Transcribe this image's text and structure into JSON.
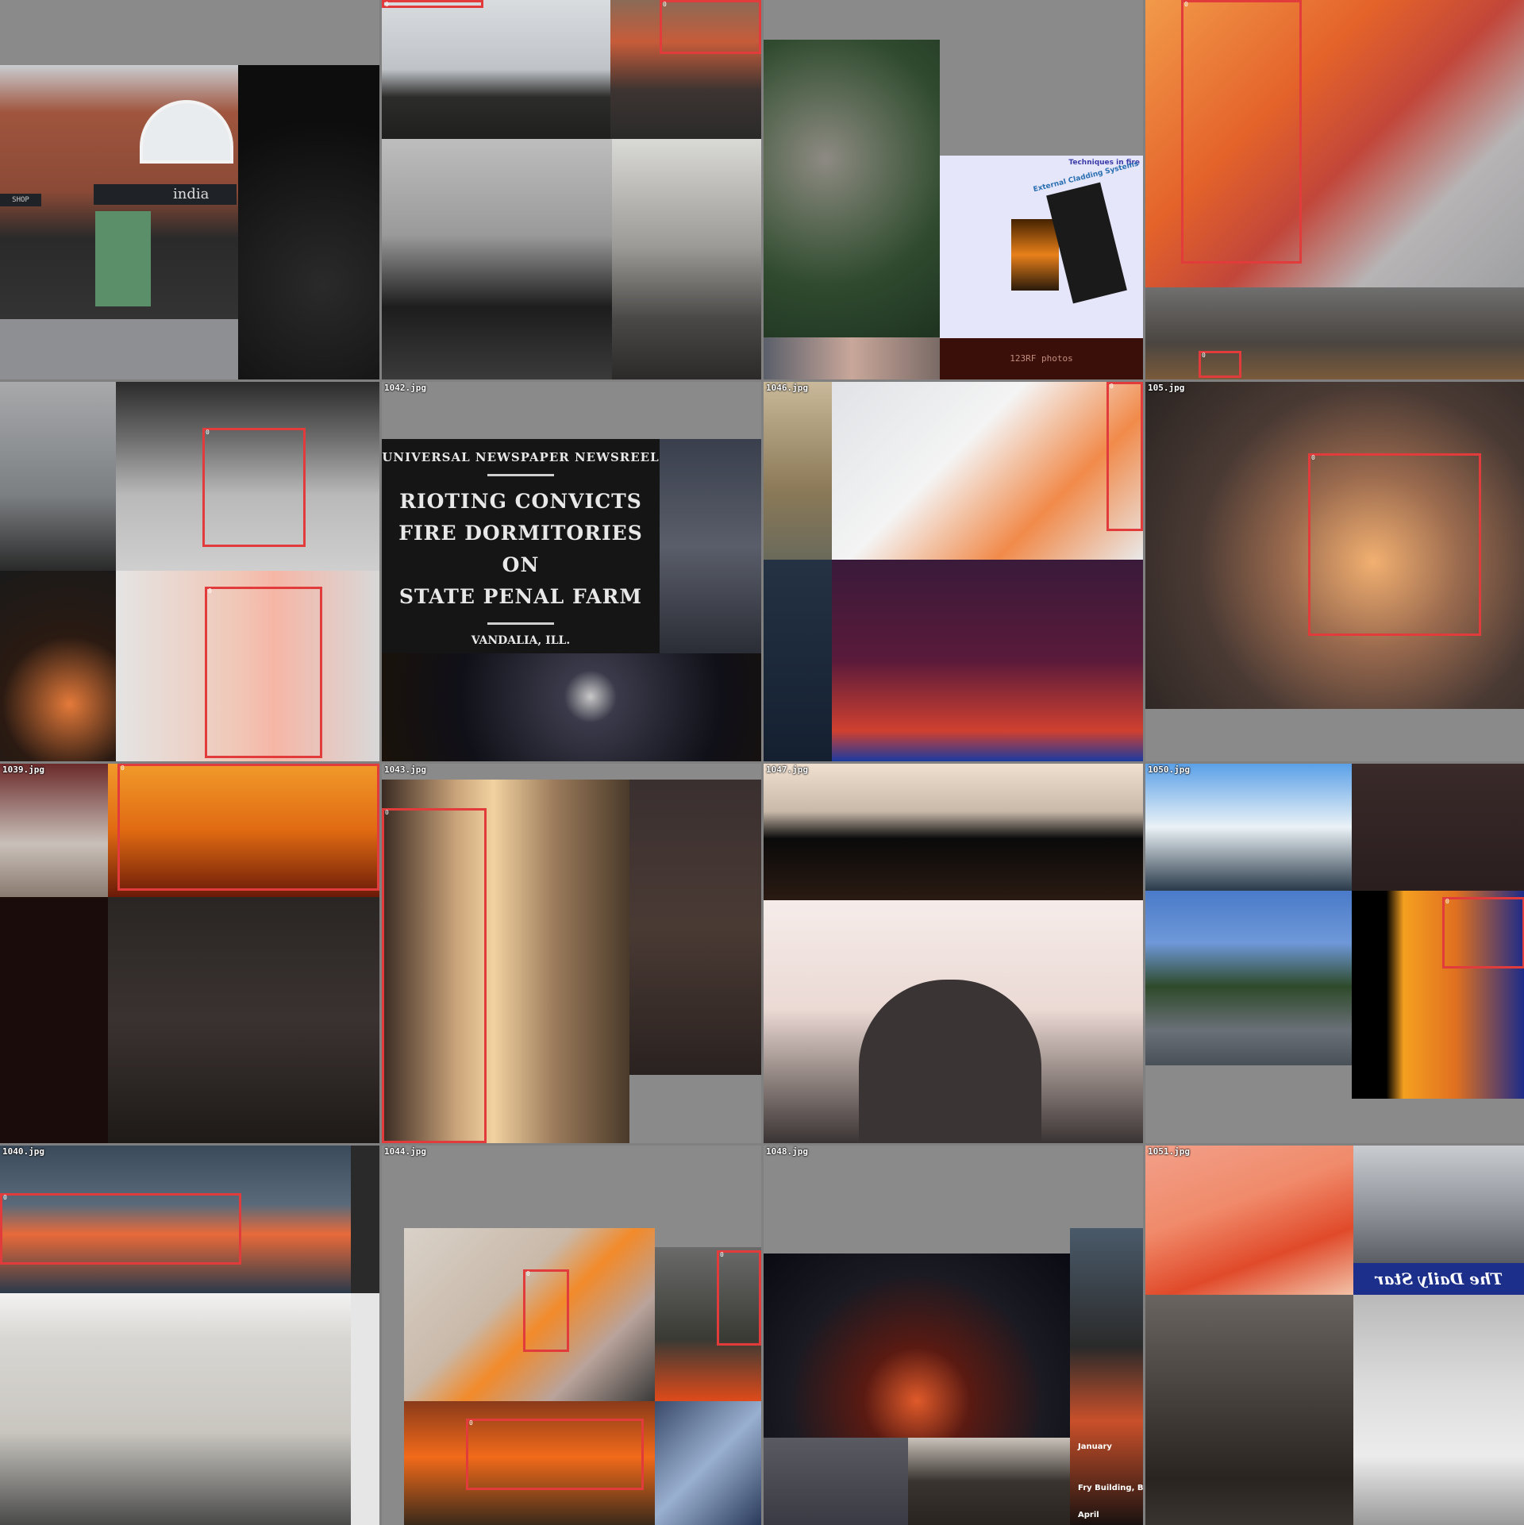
{
  "grid_labels": {
    "c5": "105.jpg",
    "c6": "1039.jpg",
    "c7": "1042.jpg",
    "c8": "1043.jpg",
    "c9": "1046.jpg",
    "c10": "1047.jpg",
    "c11": "1050.jpg",
    "c12": "1040.jpg",
    "c13": "1044.jpg",
    "c14": "1048.jpg",
    "c15": "1051.jpg"
  },
  "bbox_label": "0",
  "texts": {
    "shop_sign": "india",
    "shop_left": "SHOP",
    "doc_title": "Techniques in fire",
    "doc_side": "External Cladding Systems",
    "watermark": "123RF photos",
    "news_l1": "UNIVERSAL NEWSPAPER NEWSREEL",
    "news_big1": "RIOTING CONVICTS",
    "news_big2": "FIRE DORMITORIES ON",
    "news_big3": "STATE PENAL FARM",
    "news_place": "VANDALIA, ILL.",
    "daily_star": "The Daily Star",
    "cap_january": "January",
    "cap_fry": "Fry Building, Bristol",
    "cap_april": "April"
  },
  "colors": {
    "bbox": "#e23b3b",
    "background": "#808080"
  }
}
